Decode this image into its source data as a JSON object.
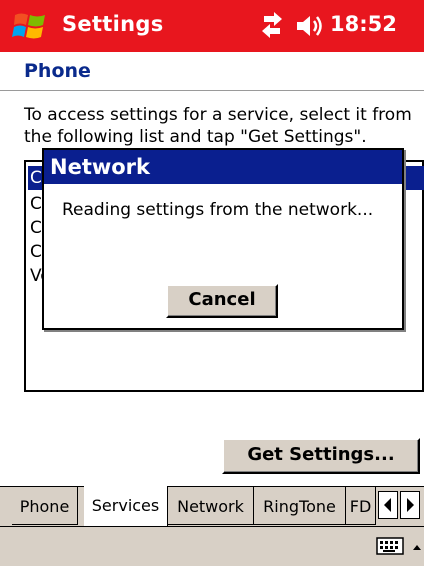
{
  "titlebar": {
    "title": "Settings",
    "time": "18:52",
    "start_icon": "windows-flag-icon",
    "connectivity_icon": "connectivity-icon",
    "volume_icon": "speaker-icon",
    "color": "#e8161e"
  },
  "page": {
    "title": "Phone",
    "title_color": "#0a2a8c"
  },
  "instructions": "To access settings for a service, select it from the following list and tap \"Get Settings\".",
  "list": {
    "items": [
      "Ca",
      "Ca",
      "Ca",
      "Ca",
      "Vo"
    ],
    "selected_index": 0,
    "selection_color": "#0a1f8f"
  },
  "buttons": {
    "get_settings": "Get Settings..."
  },
  "tabs": [
    {
      "label": "Phone",
      "active": false
    },
    {
      "label": "Services",
      "active": true
    },
    {
      "label": "Network",
      "active": false
    },
    {
      "label": "RingTone",
      "active": false
    },
    {
      "label": "FD",
      "active": false
    }
  ],
  "command_bar": {
    "keyboard_icon": "keyboard-icon",
    "arrow_icon": "caret-up-icon"
  },
  "dialog": {
    "title": "Network",
    "message": "Reading settings from the network...",
    "cancel_label": "Cancel"
  }
}
